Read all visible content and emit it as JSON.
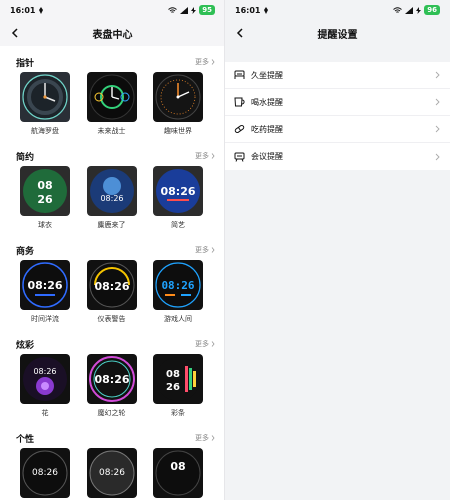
{
  "left": {
    "status": {
      "time": "16:01",
      "battery": "95"
    },
    "title": "表盘中心",
    "more_label": "更多",
    "sections": [
      {
        "title": "指针",
        "faces": [
          {
            "label": "航海罗盘",
            "digits": ""
          },
          {
            "label": "未来战士",
            "digits": ""
          },
          {
            "label": "趣味世界",
            "digits": ""
          }
        ]
      },
      {
        "title": "简约",
        "faces": [
          {
            "label": "球衣",
            "digits": "08 26"
          },
          {
            "label": "麋鹿来了",
            "digits": "08:26"
          },
          {
            "label": "简艺",
            "digits": "08:26"
          }
        ]
      },
      {
        "title": "商务",
        "faces": [
          {
            "label": "时间洋流",
            "digits": "08:26"
          },
          {
            "label": "仪表警告",
            "digits": "08:26"
          },
          {
            "label": "游戏人间",
            "digits": "08:26"
          }
        ]
      },
      {
        "title": "炫彩",
        "faces": [
          {
            "label": "花",
            "digits": "08:26"
          },
          {
            "label": "魔幻之轮",
            "digits": "08:26"
          },
          {
            "label": "彩条",
            "digits": "08 26"
          }
        ]
      },
      {
        "title": "个性",
        "faces": [
          {
            "label": "",
            "digits": "08:26"
          },
          {
            "label": "",
            "digits": "08:26"
          },
          {
            "label": "",
            "digits": "08"
          }
        ]
      }
    ]
  },
  "right": {
    "status": {
      "time": "16:01",
      "battery": "96"
    },
    "title": "提醒设置",
    "items": [
      {
        "label": "久坐提醒",
        "icon": "seat-icon"
      },
      {
        "label": "喝水提醒",
        "icon": "cup-icon"
      },
      {
        "label": "吃药提醒",
        "icon": "pill-icon"
      },
      {
        "label": "会议提醒",
        "icon": "meeting-icon"
      }
    ]
  },
  "colors": {
    "accent_green": "#2fbf55",
    "face_bg": "#111111"
  }
}
